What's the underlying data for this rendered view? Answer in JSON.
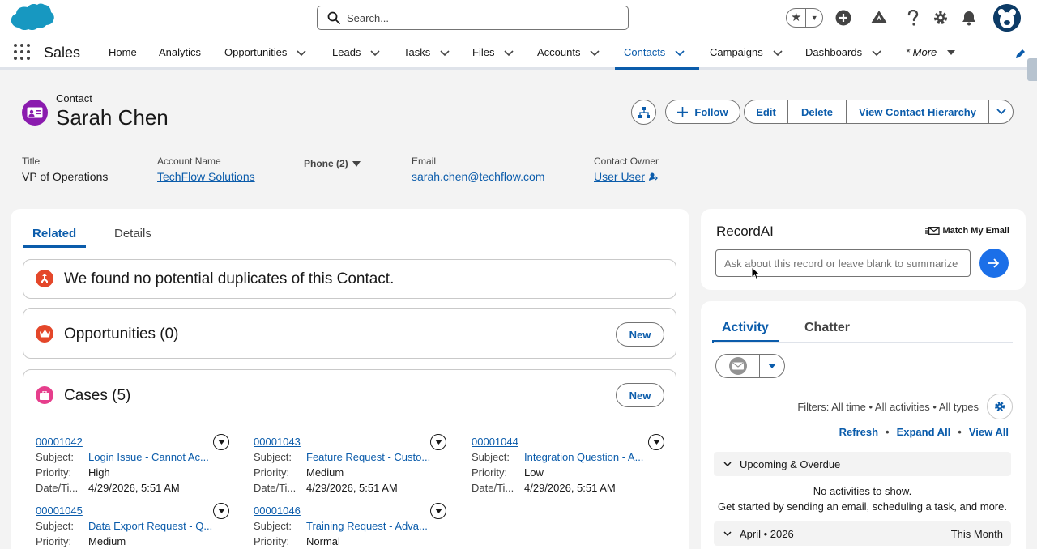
{
  "header": {
    "search_placeholder": "Search..."
  },
  "nav": {
    "app_name": "Sales",
    "items": [
      {
        "label": "Home",
        "chevron": false
      },
      {
        "label": "Analytics",
        "chevron": false
      },
      {
        "label": "Opportunities",
        "chevron": true
      },
      {
        "label": "Leads",
        "chevron": true
      },
      {
        "label": "Tasks",
        "chevron": true
      },
      {
        "label": "Files",
        "chevron": true
      },
      {
        "label": "Accounts",
        "chevron": true
      },
      {
        "label": "Contacts",
        "chevron": true,
        "active": true
      },
      {
        "label": "Campaigns",
        "chevron": true
      },
      {
        "label": "Dashboards",
        "chevron": true
      },
      {
        "label": "* More",
        "chevron": true
      }
    ]
  },
  "record": {
    "type": "Contact",
    "name": "Sarah Chen",
    "actions": {
      "follow": "Follow",
      "edit": "Edit",
      "delete": "Delete",
      "hierarchy": "View Contact Hierarchy"
    },
    "fields": {
      "title_label": "Title",
      "title_value": "VP of Operations",
      "account_label": "Account Name",
      "account_value": "TechFlow Solutions",
      "phone_label": "Phone (2)",
      "email_label": "Email",
      "email_value": "sarah.chen@techflow.com",
      "owner_label": "Contact Owner",
      "owner_value": "User User"
    }
  },
  "tabs": {
    "related": "Related",
    "details": "Details"
  },
  "duplicates": {
    "message": "We found no potential duplicates of this Contact."
  },
  "opportunities": {
    "title": "Opportunities (0)",
    "new_label": "New"
  },
  "cases": {
    "title": "Cases (5)",
    "new_label": "New",
    "labels": {
      "subject": "Subject:",
      "priority": "Priority:",
      "datetime": "Date/Ti..."
    },
    "items": [
      {
        "number": "00001042",
        "subject": "Login Issue - Cannot Ac...",
        "priority": "High",
        "date": "4/29/2026, 5:51 AM"
      },
      {
        "number": "00001043",
        "subject": "Feature Request - Custo...",
        "priority": "Medium",
        "date": "4/29/2026, 5:51 AM"
      },
      {
        "number": "00001044",
        "subject": "Integration Question - A...",
        "priority": "Low",
        "date": "4/29/2026, 5:51 AM"
      },
      {
        "number": "00001045",
        "subject": "Data Export Request - Q...",
        "priority": "Medium",
        "date": ""
      },
      {
        "number": "00001046",
        "subject": "Training Request - Adva...",
        "priority": "Normal",
        "date": ""
      }
    ]
  },
  "record_ai": {
    "title": "RecordAI",
    "match_email": "Match My Email",
    "input_placeholder": "Ask about this record or leave blank to summarize"
  },
  "activity": {
    "tab_activity": "Activity",
    "tab_chatter": "Chatter",
    "filters": "Filters: All time • All activities • All types",
    "refresh": "Refresh",
    "expand_all": "Expand All",
    "view_all": "View All",
    "upcoming": "Upcoming & Overdue",
    "no_activities": "No activities to show.",
    "get_started": "Get started by sending an email, scheduling a task, and more.",
    "month": "April • 2026",
    "this_month": "This Month"
  },
  "colors": {
    "brand_blue": "#0b5cab",
    "contact_icon": "#8a1bae",
    "duplicate_icon": "#e4472a",
    "opportunity_icon": "#e4472a",
    "case_icon": "#e63e8c",
    "send_button": "#1b6fe8"
  }
}
